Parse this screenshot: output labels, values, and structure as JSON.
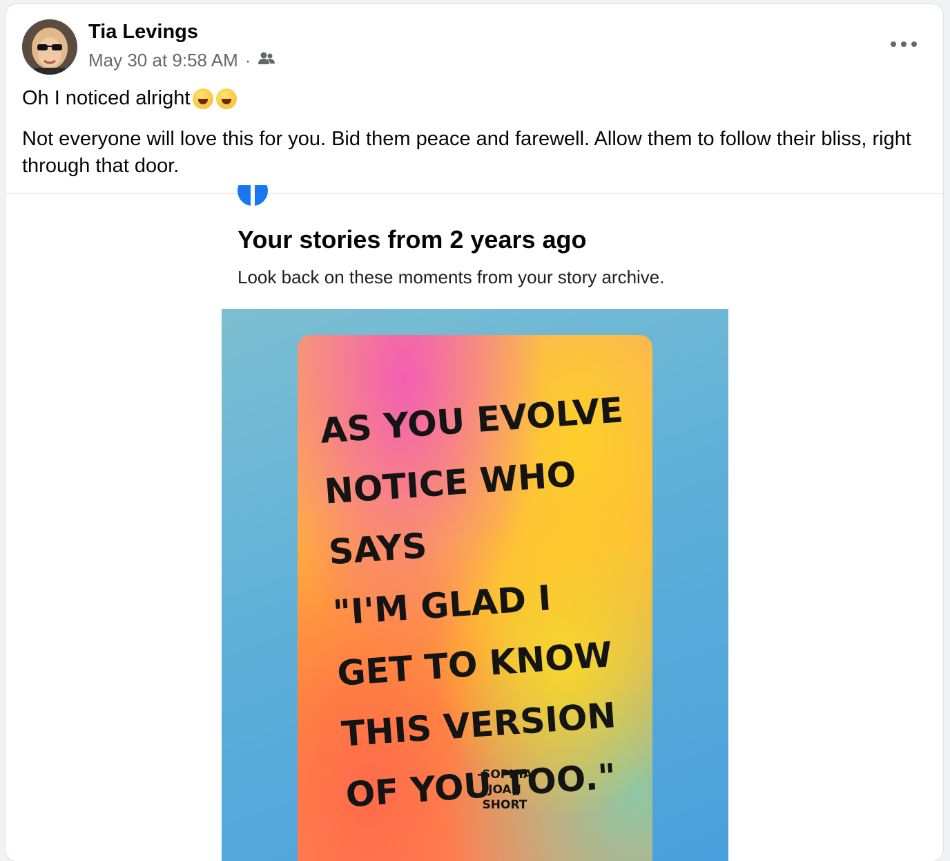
{
  "post": {
    "author": "Tia Levings",
    "timestamp": "May 30 at 9:58 AM",
    "separator": "·",
    "audience_icon": "friends-icon",
    "more_icon": "more-options-icon",
    "line1_text": "Oh I noticed alright",
    "line1_emojis": [
      "rolling-on-floor-laughing-emoji",
      "rolling-on-floor-laughing-emoji"
    ],
    "body": "Not everyone will love this for you. Bid them peace and farewell. Allow them to follow their bliss, right through that door."
  },
  "memory": {
    "logo_icon": "facebook-logo-icon",
    "title": "Your stories from 2 years ago",
    "subtitle": "Look back on these moments from your story archive."
  },
  "story_card": {
    "quote": "As you evolve\nnotice who says\n\"I'm glad I\nget to know\nthis version\nof you too.\"",
    "credit": "-Sophia\nJoan\nShort"
  },
  "colors": {
    "facebook_blue": "#1877f2",
    "secondary_text": "#65676b"
  }
}
